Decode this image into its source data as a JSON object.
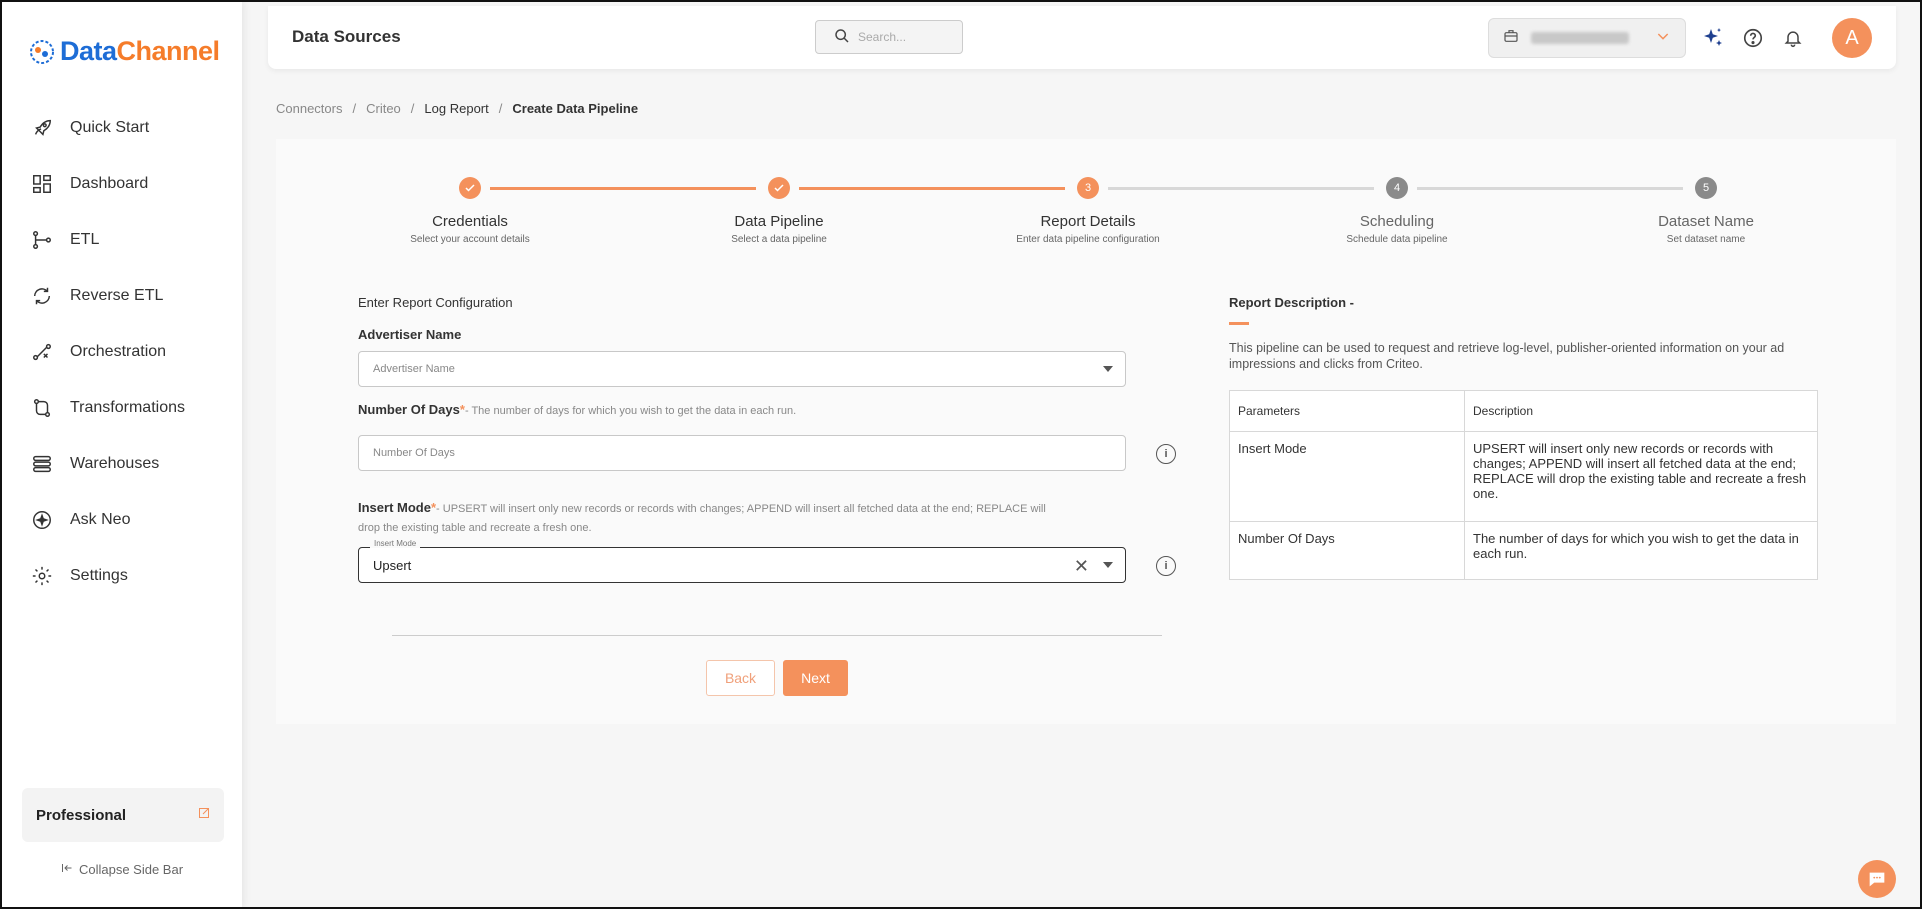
{
  "app": {
    "logo_part1": "Data",
    "logo_part2": "Channel"
  },
  "sidebar": {
    "items": [
      {
        "label": "Quick Start",
        "icon": "rocket-icon"
      },
      {
        "label": "Dashboard",
        "icon": "dashboard-icon"
      },
      {
        "label": "ETL",
        "icon": "etl-icon"
      },
      {
        "label": "Reverse ETL",
        "icon": "reverse-etl-icon"
      },
      {
        "label": "Orchestration",
        "icon": "orchestration-icon"
      },
      {
        "label": "Transformations",
        "icon": "transformations-icon"
      },
      {
        "label": "Warehouses",
        "icon": "warehouses-icon"
      },
      {
        "label": "Ask Neo",
        "icon": "ask-neo-icon"
      },
      {
        "label": "Settings",
        "icon": "gear-icon"
      }
    ],
    "plan": "Professional",
    "collapse": "Collapse Side Bar"
  },
  "header": {
    "title": "Data Sources",
    "search_placeholder": "Search...",
    "avatar_initial": "A"
  },
  "breadcrumb": {
    "items": [
      "Connectors",
      "Criteo",
      "Log Report",
      "Create Data Pipeline"
    ],
    "separator": "/"
  },
  "stepper": {
    "steps": [
      {
        "title": "Credentials",
        "sub": "Select your account details",
        "state": "done",
        "num": "1"
      },
      {
        "title": "Data Pipeline",
        "sub": "Select a data pipeline",
        "state": "done",
        "num": "2"
      },
      {
        "title": "Report Details",
        "sub": "Enter data pipeline configuration",
        "state": "active",
        "num": "3"
      },
      {
        "title": "Scheduling",
        "sub": "Schedule data pipeline",
        "state": "pending",
        "num": "4"
      },
      {
        "title": "Dataset Name",
        "sub": "Set dataset name",
        "state": "pending",
        "num": "5"
      }
    ]
  },
  "form": {
    "section_title": "Enter Report Configuration",
    "advertiser": {
      "label": "Advertiser Name",
      "placeholder": "Advertiser Name"
    },
    "days": {
      "label": "Number Of Days",
      "required": "*",
      "hint": "- The number of days for which you wish to get the data in each run.",
      "placeholder": "Number Of Days"
    },
    "insert_mode": {
      "label": "Insert Mode",
      "required": "*",
      "hint": "- UPSERT will insert only new records or records with changes; APPEND will insert all fetched data at the end; REPLACE will drop the existing table and recreate a fresh one.",
      "float_label": "Insert Mode",
      "value": "Upsert"
    },
    "back": "Back",
    "next": "Next"
  },
  "description": {
    "title": "Report Description -",
    "text": "This pipeline can be used to request and retrieve log-level, publisher-oriented information on your ad impressions and clicks from Criteo.",
    "table": {
      "headers": [
        "Parameters",
        "Description"
      ],
      "rows": [
        [
          "Insert Mode",
          "UPSERT will insert only new records or records with changes; APPEND will insert all fetched data at the end; REPLACE will drop the existing table and recreate a fresh one."
        ],
        [
          "Number Of Days",
          "The number of days for which you wish to get the data in each run."
        ]
      ]
    }
  },
  "colors": {
    "accent": "#f4915c",
    "pending": "#8a8a8a",
    "brand_blue": "#1e6dd6"
  }
}
